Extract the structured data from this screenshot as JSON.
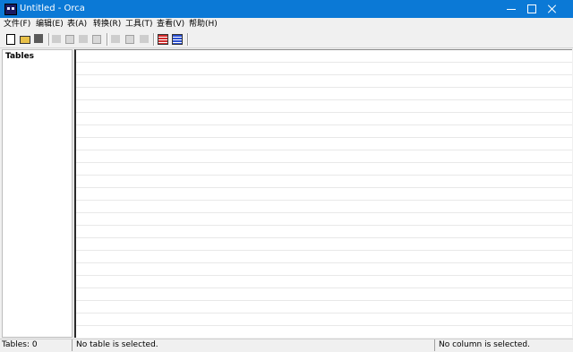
{
  "window": {
    "title": "Untitled - Orca"
  },
  "menu": {
    "items": [
      {
        "label": "文件(F)"
      },
      {
        "label": "编辑(E)"
      },
      {
        "label": "表(A)"
      },
      {
        "label": "转换(R)"
      },
      {
        "label": "工具(T)"
      },
      {
        "label": "查看(V)"
      },
      {
        "label": "帮助(H)"
      }
    ]
  },
  "toolbar": {
    "icons": [
      "new-icon",
      "open-icon",
      "save-icon",
      "cut-icon",
      "copy-icon",
      "paste-icon",
      "find-icon",
      "table-icon-1",
      "table-icon-2",
      "table-icon-3",
      "validate-icon",
      "merge-icon"
    ]
  },
  "tables_pane": {
    "header": "Tables"
  },
  "statusbar": {
    "tables_count": "Tables: 0",
    "table_selection": "No table is selected.",
    "column_selection": "No column is selected."
  },
  "colors": {
    "titlebar": "#0b79d6",
    "chrome": "#f0f0f0"
  }
}
